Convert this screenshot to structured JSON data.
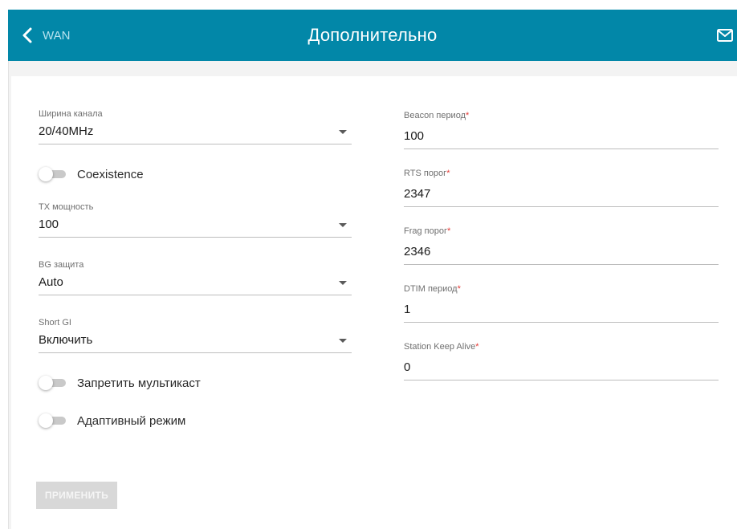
{
  "header": {
    "back_label": "WAN",
    "title": "Дополнительно",
    "bg_color": "#0287a8"
  },
  "left": {
    "channel_width": {
      "label": "Ширина канала",
      "value": "20/40MHz"
    },
    "coexistence": {
      "label": "Coexistence",
      "on": false
    },
    "tx_power": {
      "label": "TX мощность",
      "value": "100"
    },
    "bg_protection": {
      "label": "BG защита",
      "value": "Auto"
    },
    "short_gi": {
      "label": "Short GI",
      "value": "Включить"
    },
    "disable_multicast": {
      "label": "Запретить мультикаст",
      "on": false
    },
    "adaptive_mode": {
      "label": "Адаптивный режим",
      "on": false
    }
  },
  "right": {
    "beacon_period": {
      "label": "Beacon период",
      "required_mark": "*",
      "value": "100"
    },
    "rts_threshold": {
      "label": "RTS порог",
      "required_mark": "*",
      "value": "2347"
    },
    "frag_threshold": {
      "label": "Frag порог",
      "required_mark": "*",
      "value": "2346"
    },
    "dtim_period": {
      "label": "DTIM период",
      "required_mark": "*",
      "value": "1"
    },
    "station_keep_alive": {
      "label": "Station Keep Alive",
      "required_mark": "*",
      "value": "0"
    }
  },
  "apply_button": {
    "label": "ПРИМЕНИТЬ",
    "disabled": true
  },
  "icons": {
    "back": "chevron-left-icon",
    "mail": "mail-icon",
    "dropdown": "caret-down-icon"
  }
}
